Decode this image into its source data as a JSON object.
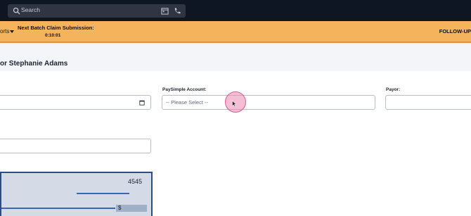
{
  "topbar": {
    "search_placeholder": "Search",
    "icons": [
      "search-icon",
      "calendar-icon",
      "phone-icon"
    ]
  },
  "batchbar": {
    "reports_label": "orts",
    "batch_title": "Next Batch Claim Submission:",
    "batch_time": "0:10:01",
    "followup_label": "FOLLOW-UP"
  },
  "page": {
    "title": "or Stephanie Adams"
  },
  "form": {
    "paysimple_label": "PaySimple Account:",
    "paysimple_value": "-- Please Select --",
    "payor_label": "Payor:"
  },
  "check": {
    "number": "4545",
    "currency_symbol": "$"
  },
  "colors": {
    "topbar": "#0f1623",
    "batchbar": "#f5b35c",
    "check_border": "#2c4b87"
  }
}
